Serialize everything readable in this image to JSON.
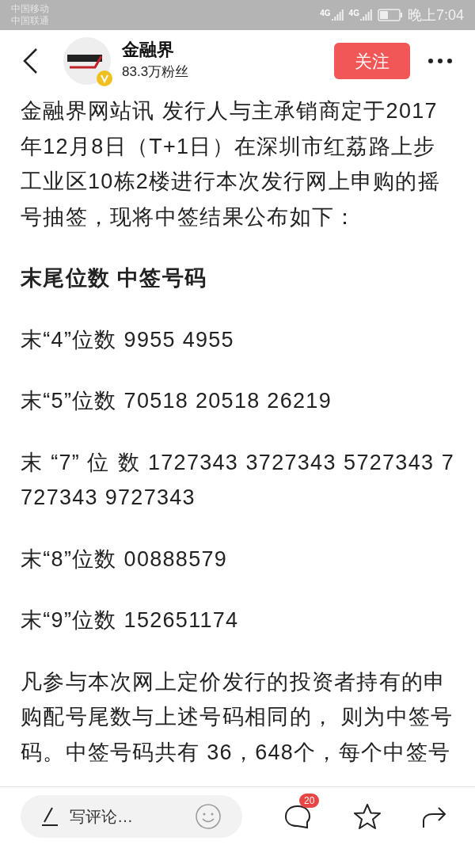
{
  "status_bar": {
    "carriers": [
      "中国移动",
      "中国联通"
    ],
    "network": [
      "4G",
      "4G"
    ],
    "time": "晚上7:04"
  },
  "header": {
    "account_name": "金融界",
    "followers": "83.3万粉丝",
    "follow_button": "关注"
  },
  "article": [
    {
      "kind": "paragraph",
      "text": "金融界网站讯 发行人与主承销商定于2017年12月8日（T+1日）在深圳市红荔路上步工业区10栋2楼进行本次发行网上申购的摇号抽签，现将中签结果公布如下："
    },
    {
      "kind": "heading",
      "text": "末尾位数 中签号码"
    },
    {
      "kind": "paragraph",
      "text": "末“4”位数 9955 4955"
    },
    {
      "kind": "paragraph",
      "text": "末“5”位数 70518 20518 26219"
    },
    {
      "kind": "justified",
      "text": "末 “7” 位 数  1727343 3727343 5727343 7727343 9727343"
    },
    {
      "kind": "paragraph",
      "text": "末“8”位数 00888579"
    },
    {
      "kind": "paragraph",
      "text": "末“9”位数 152651174"
    },
    {
      "kind": "paragraph",
      "text": "凡参与本次网上定价发行的投资者持有的申购配号尾数与上述号码相同的， 则为中签号码。中签号码共有 36，648个，每个中签号"
    }
  ],
  "bottom_bar": {
    "comment_placeholder": "写评论…",
    "comment_count": "20"
  }
}
